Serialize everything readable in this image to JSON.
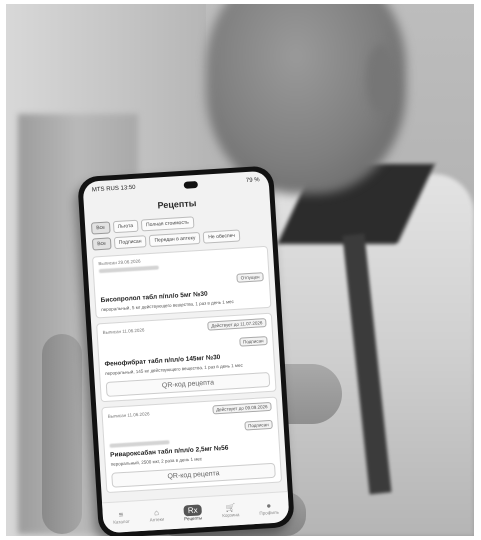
{
  "status_bar": {
    "carrier_time": "MTS RUS 13:50",
    "battery": "79 %"
  },
  "app": {
    "title": "Рецепты"
  },
  "filters": {
    "row1": [
      {
        "label": "Все",
        "active": true
      },
      {
        "label": "Льгота",
        "active": false
      },
      {
        "label": "Полная стоимость",
        "active": false
      }
    ],
    "row2": [
      {
        "label": "Все",
        "active": true
      },
      {
        "label": "Подписан",
        "active": false
      },
      {
        "label": "Передан в аптеку",
        "active": false
      },
      {
        "label": "Не обеспеч",
        "active": false
      }
    ]
  },
  "prescriptions": [
    {
      "issued": "Выписан 29.06.2026",
      "badge": "Отпущен",
      "drug": "Бисопролол табл п/пл/о 5мг №30",
      "desc": "пероральный, 5 мг действующего вещества, 1 раз в день 1 мес"
    },
    {
      "issued": "Выписан 11.06.2026",
      "valid": "Действует до 11.07.2026",
      "badge": "Подписан",
      "drug": "Фенофибрат табл п/пл/о 145мг №30",
      "desc": "пероральный, 145 мг действующего вещества, 1 раз в день 1 мес",
      "qr_label": "QR-код рецепта"
    },
    {
      "issued": "Выписан 11.06.2026",
      "valid": "Действует до 09.09.2026",
      "badge": "Подписан",
      "drug": "Ривароксабан табл п/пл/о 2,5мг №56",
      "desc": "пероральный, 2500 мкг, 2 раза в день 1 мес",
      "qr_label": "QR-код рецепта"
    }
  ],
  "tabbar": [
    {
      "icon": "menu-icon",
      "glyph": "≡",
      "label": "Каталог"
    },
    {
      "icon": "home-icon",
      "glyph": "⌂",
      "label": "Аптеки"
    },
    {
      "icon": "prescription-icon",
      "glyph": "Rx",
      "label": "Рецепты"
    },
    {
      "icon": "cart-icon",
      "glyph": "🛒",
      "label": "Корзина"
    },
    {
      "icon": "profile-icon",
      "glyph": "●",
      "label": "Профиль"
    }
  ]
}
